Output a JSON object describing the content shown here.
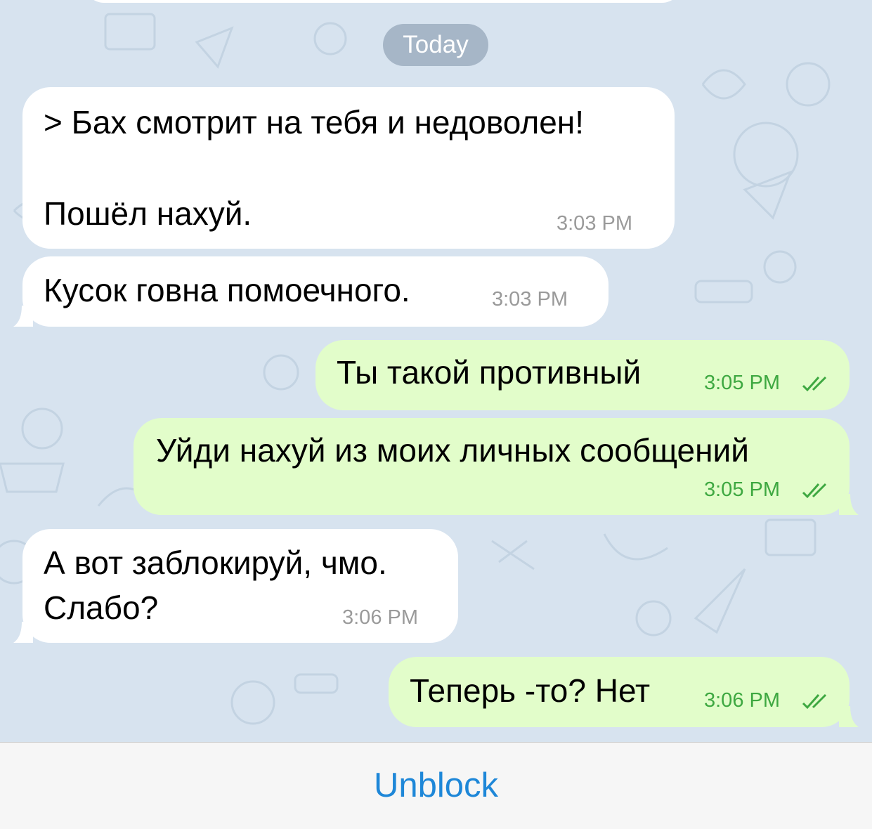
{
  "chat": {
    "date_separator": "Today",
    "messages": [
      {
        "direction": "incoming",
        "lines": [
          "> Бах смотрит на тебя и недоволен!",
          "",
          "Пошёл нахуй."
        ],
        "time": "3:03 PM"
      },
      {
        "direction": "incoming",
        "lines": [
          "Кусок говна помоечного."
        ],
        "time": "3:03 PM"
      },
      {
        "direction": "outgoing",
        "lines": [
          "Ты такой противный"
        ],
        "time": "3:05 PM",
        "status": "read"
      },
      {
        "direction": "outgoing",
        "lines": [
          "Уйди нахуй из моих личных сообщений"
        ],
        "time": "3:05 PM",
        "status": "read"
      },
      {
        "direction": "incoming",
        "lines": [
          "А вот заблокируй, чмо.",
          "Слабо?"
        ],
        "time": "3:06 PM"
      },
      {
        "direction": "outgoing",
        "lines": [
          "Теперь -то? Нет"
        ],
        "time": "3:06 PM",
        "status": "read"
      }
    ]
  },
  "footer": {
    "unblock_label": "Unblock"
  },
  "colors": {
    "background": "#d7e3ef",
    "incoming_bubble": "#ffffff",
    "outgoing_bubble": "#e2fdca",
    "outgoing_time": "#3ea841",
    "incoming_time": "#9a9a9a",
    "accent": "#1e87d8"
  },
  "icons": {
    "read_status": "double-check-icon"
  }
}
